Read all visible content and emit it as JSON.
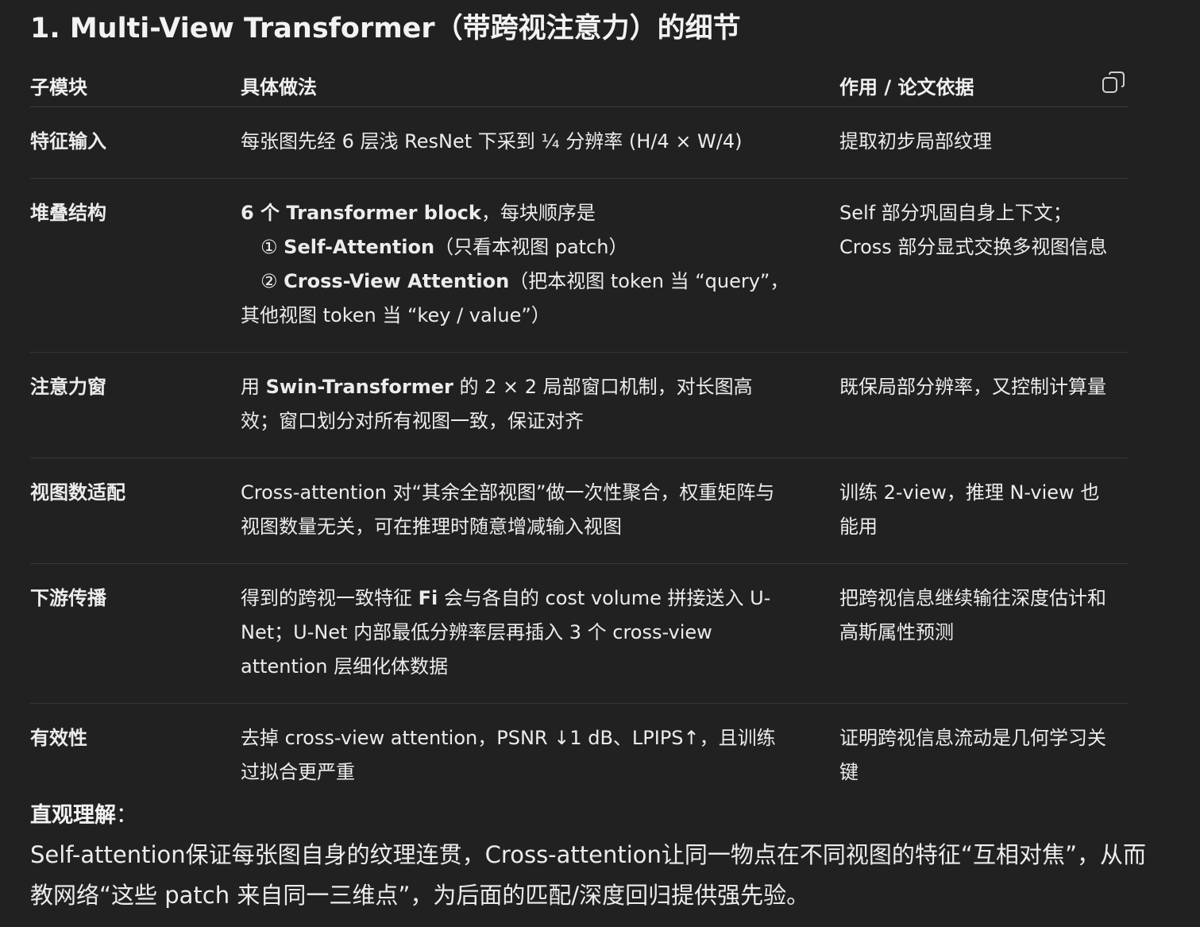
{
  "heading": "1. Multi-View Transformer（带跨视注意力）的细节",
  "table": {
    "headers": [
      "子模块",
      "具体做法",
      "作用 / 论文依据"
    ],
    "copy_icon": "copy-icon",
    "rows": [
      {
        "name": "特征输入",
        "detail_lines": [
          "每张图先经 6 层浅 ResNet 下采到 ¼ 分辨率 (H/4 × W/4)"
        ],
        "purpose_lines": [
          "提取初步局部纹理"
        ]
      },
      {
        "name": "堆叠结构",
        "detail": {
          "l1_bold": "6 个 Transformer block",
          "l1_rest": "，每块顺序是",
          "l2_pre": "① ",
          "l2_bold": "Self-Attention",
          "l2_rest": "（只看本视图 patch）",
          "l3_pre": "② ",
          "l3_bold": "Cross-View Attention",
          "l3_rest": "（把本视图 token 当 “query”，",
          "l4": "其他视图 token 当 “key / value”）"
        },
        "purpose_lines": [
          "Self 部分巩固自身上下文；",
          "Cross 部分显式交换多视图信息"
        ]
      },
      {
        "name": "注意力窗",
        "detail": {
          "l1_pre": "用 ",
          "l1_bold": "Swin-Transformer",
          "l1_rest": " 的 2 × 2 局部窗口机制，对长图高",
          "l2": "效；窗口划分对所有视图一致，保证对齐"
        },
        "purpose_lines": [
          "既保局部分辨率，又控制计算量"
        ]
      },
      {
        "name": "视图数适配",
        "detail_lines": [
          "Cross-attention 对“其余全部视图”做一次性聚合，权重矩阵与",
          "视图数量无关，可在推理时随意增减输入视图"
        ],
        "purpose_lines": [
          "训练 2-view，推理 N-view 也",
          "能用"
        ]
      },
      {
        "name": "下游传播",
        "detail": {
          "l1_pre": "得到的跨视一致特征 ",
          "l1_bold": "Fi",
          "l1_rest": " 会与各自的 cost volume 拼接送入 U-",
          "l2": "Net；U-Net 内部最低分辨率层再插入 3 个 cross-view",
          "l3": "attention 层细化体数据"
        },
        "purpose_lines": [
          "把跨视信息继续输往深度估计和",
          "高斯属性预测"
        ]
      },
      {
        "name": "有效性",
        "detail_lines": [
          "去掉 cross-view attention，PSNR ↓1 dB、LPIPS↑，且训练",
          "过拟合更严重"
        ],
        "purpose_lines": [
          "证明跨视信息流动是几何学习关",
          "键"
        ]
      }
    ]
  },
  "summary": {
    "title_bold": "直观理解",
    "title_colon": "：",
    "lines": [
      "Self-attention保证每张图自身的纹理连贯，Cross-attention让同一物点在不同视图的特征“互相对焦”，从而",
      "教网络“这些 patch 来自同一三维点”，为后面的匹配/深度回归提供强先验。"
    ]
  }
}
